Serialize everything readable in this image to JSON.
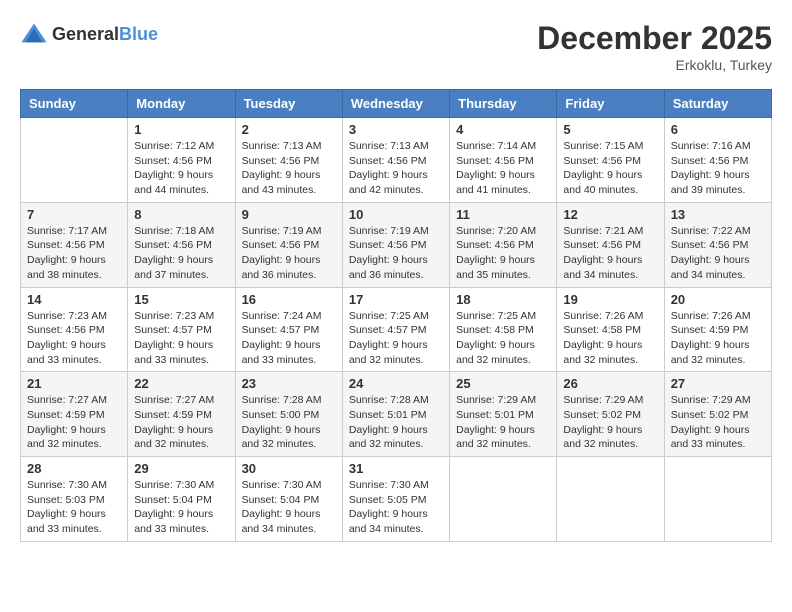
{
  "header": {
    "logo_general": "General",
    "logo_blue": "Blue",
    "month_title": "December 2025",
    "location": "Erkoklu, Turkey"
  },
  "days_of_week": [
    "Sunday",
    "Monday",
    "Tuesday",
    "Wednesday",
    "Thursday",
    "Friday",
    "Saturday"
  ],
  "weeks": [
    [
      {
        "day": "",
        "sunrise": "",
        "sunset": "",
        "daylight": ""
      },
      {
        "day": "1",
        "sunrise": "Sunrise: 7:12 AM",
        "sunset": "Sunset: 4:56 PM",
        "daylight": "Daylight: 9 hours and 44 minutes."
      },
      {
        "day": "2",
        "sunrise": "Sunrise: 7:13 AM",
        "sunset": "Sunset: 4:56 PM",
        "daylight": "Daylight: 9 hours and 43 minutes."
      },
      {
        "day": "3",
        "sunrise": "Sunrise: 7:13 AM",
        "sunset": "Sunset: 4:56 PM",
        "daylight": "Daylight: 9 hours and 42 minutes."
      },
      {
        "day": "4",
        "sunrise": "Sunrise: 7:14 AM",
        "sunset": "Sunset: 4:56 PM",
        "daylight": "Daylight: 9 hours and 41 minutes."
      },
      {
        "day": "5",
        "sunrise": "Sunrise: 7:15 AM",
        "sunset": "Sunset: 4:56 PM",
        "daylight": "Daylight: 9 hours and 40 minutes."
      },
      {
        "day": "6",
        "sunrise": "Sunrise: 7:16 AM",
        "sunset": "Sunset: 4:56 PM",
        "daylight": "Daylight: 9 hours and 39 minutes."
      }
    ],
    [
      {
        "day": "7",
        "sunrise": "Sunrise: 7:17 AM",
        "sunset": "Sunset: 4:56 PM",
        "daylight": "Daylight: 9 hours and 38 minutes."
      },
      {
        "day": "8",
        "sunrise": "Sunrise: 7:18 AM",
        "sunset": "Sunset: 4:56 PM",
        "daylight": "Daylight: 9 hours and 37 minutes."
      },
      {
        "day": "9",
        "sunrise": "Sunrise: 7:19 AM",
        "sunset": "Sunset: 4:56 PM",
        "daylight": "Daylight: 9 hours and 36 minutes."
      },
      {
        "day": "10",
        "sunrise": "Sunrise: 7:19 AM",
        "sunset": "Sunset: 4:56 PM",
        "daylight": "Daylight: 9 hours and 36 minutes."
      },
      {
        "day": "11",
        "sunrise": "Sunrise: 7:20 AM",
        "sunset": "Sunset: 4:56 PM",
        "daylight": "Daylight: 9 hours and 35 minutes."
      },
      {
        "day": "12",
        "sunrise": "Sunrise: 7:21 AM",
        "sunset": "Sunset: 4:56 PM",
        "daylight": "Daylight: 9 hours and 34 minutes."
      },
      {
        "day": "13",
        "sunrise": "Sunrise: 7:22 AM",
        "sunset": "Sunset: 4:56 PM",
        "daylight": "Daylight: 9 hours and 34 minutes."
      }
    ],
    [
      {
        "day": "14",
        "sunrise": "Sunrise: 7:23 AM",
        "sunset": "Sunset: 4:56 PM",
        "daylight": "Daylight: 9 hours and 33 minutes."
      },
      {
        "day": "15",
        "sunrise": "Sunrise: 7:23 AM",
        "sunset": "Sunset: 4:57 PM",
        "daylight": "Daylight: 9 hours and 33 minutes."
      },
      {
        "day": "16",
        "sunrise": "Sunrise: 7:24 AM",
        "sunset": "Sunset: 4:57 PM",
        "daylight": "Daylight: 9 hours and 33 minutes."
      },
      {
        "day": "17",
        "sunrise": "Sunrise: 7:25 AM",
        "sunset": "Sunset: 4:57 PM",
        "daylight": "Daylight: 9 hours and 32 minutes."
      },
      {
        "day": "18",
        "sunrise": "Sunrise: 7:25 AM",
        "sunset": "Sunset: 4:58 PM",
        "daylight": "Daylight: 9 hours and 32 minutes."
      },
      {
        "day": "19",
        "sunrise": "Sunrise: 7:26 AM",
        "sunset": "Sunset: 4:58 PM",
        "daylight": "Daylight: 9 hours and 32 minutes."
      },
      {
        "day": "20",
        "sunrise": "Sunrise: 7:26 AM",
        "sunset": "Sunset: 4:59 PM",
        "daylight": "Daylight: 9 hours and 32 minutes."
      }
    ],
    [
      {
        "day": "21",
        "sunrise": "Sunrise: 7:27 AM",
        "sunset": "Sunset: 4:59 PM",
        "daylight": "Daylight: 9 hours and 32 minutes."
      },
      {
        "day": "22",
        "sunrise": "Sunrise: 7:27 AM",
        "sunset": "Sunset: 4:59 PM",
        "daylight": "Daylight: 9 hours and 32 minutes."
      },
      {
        "day": "23",
        "sunrise": "Sunrise: 7:28 AM",
        "sunset": "Sunset: 5:00 PM",
        "daylight": "Daylight: 9 hours and 32 minutes."
      },
      {
        "day": "24",
        "sunrise": "Sunrise: 7:28 AM",
        "sunset": "Sunset: 5:01 PM",
        "daylight": "Daylight: 9 hours and 32 minutes."
      },
      {
        "day": "25",
        "sunrise": "Sunrise: 7:29 AM",
        "sunset": "Sunset: 5:01 PM",
        "daylight": "Daylight: 9 hours and 32 minutes."
      },
      {
        "day": "26",
        "sunrise": "Sunrise: 7:29 AM",
        "sunset": "Sunset: 5:02 PM",
        "daylight": "Daylight: 9 hours and 32 minutes."
      },
      {
        "day": "27",
        "sunrise": "Sunrise: 7:29 AM",
        "sunset": "Sunset: 5:02 PM",
        "daylight": "Daylight: 9 hours and 33 minutes."
      }
    ],
    [
      {
        "day": "28",
        "sunrise": "Sunrise: 7:30 AM",
        "sunset": "Sunset: 5:03 PM",
        "daylight": "Daylight: 9 hours and 33 minutes."
      },
      {
        "day": "29",
        "sunrise": "Sunrise: 7:30 AM",
        "sunset": "Sunset: 5:04 PM",
        "daylight": "Daylight: 9 hours and 33 minutes."
      },
      {
        "day": "30",
        "sunrise": "Sunrise: 7:30 AM",
        "sunset": "Sunset: 5:04 PM",
        "daylight": "Daylight: 9 hours and 34 minutes."
      },
      {
        "day": "31",
        "sunrise": "Sunrise: 7:30 AM",
        "sunset": "Sunset: 5:05 PM",
        "daylight": "Daylight: 9 hours and 34 minutes."
      },
      {
        "day": "",
        "sunrise": "",
        "sunset": "",
        "daylight": ""
      },
      {
        "day": "",
        "sunrise": "",
        "sunset": "",
        "daylight": ""
      },
      {
        "day": "",
        "sunrise": "",
        "sunset": "",
        "daylight": ""
      }
    ]
  ]
}
